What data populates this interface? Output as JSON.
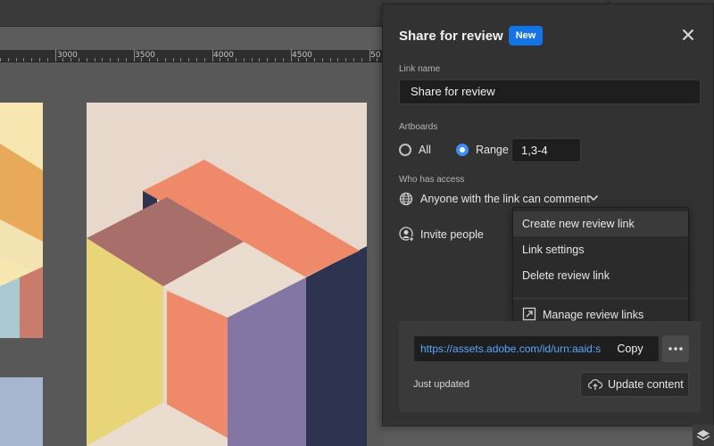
{
  "ruler": {
    "labels": [
      "3000",
      "3500",
      "4000",
      "4500",
      "50"
    ]
  },
  "panel": {
    "title": "Share for review",
    "badge": "New",
    "link_name": {
      "label": "Link name",
      "value": "Share for review"
    },
    "artboards": {
      "label": "Artboards",
      "option_all": "All",
      "option_range": "Range",
      "selected": "Range",
      "range_value": "1,3-4"
    },
    "access": {
      "label": "Who has access",
      "value": "Anyone with the link can comment"
    },
    "invite_label": "Invite people",
    "menu": {
      "items": [
        "Create new review link",
        "Link settings",
        "Delete review link"
      ],
      "manage": "Manage review links"
    },
    "link": {
      "url": "https://assets.adobe.com/id/urn:aaid:s...",
      "copy": "Copy",
      "updated": "Just updated",
      "update_button": "Update content"
    }
  },
  "colors": {
    "accent": "#1473e6",
    "link": "#5aa7ff"
  }
}
